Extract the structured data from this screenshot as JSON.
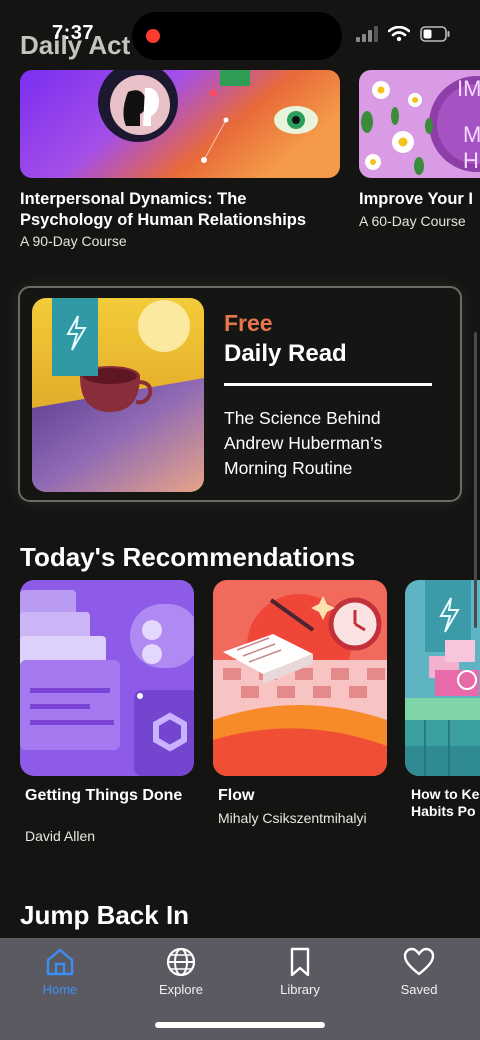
{
  "status_bar": {
    "time": "7:37"
  },
  "sections": {
    "daily_activity_title": "Daily Act",
    "recommendations_title": "Today's Recommendations",
    "jump_back_title": "Jump Back In"
  },
  "courses": [
    {
      "title": "Interpersonal Dynamics: The Psychology of Human Relationships",
      "subtitle": "A 90-Day Course"
    },
    {
      "title": "Improve Your I",
      "subtitle": "A 60-Day Course",
      "art_text_top": "IM",
      "art_text_mid": "M",
      "art_text_bot": "H"
    }
  ],
  "daily_read": {
    "badge": "Free",
    "title": "Daily Read",
    "description": "The Science Behind Andrew Huberman’s Morning Routine"
  },
  "recommendations": [
    {
      "title": "Getting Things Done",
      "author": "David Allen"
    },
    {
      "title": "Flow",
      "author": "Mihaly Csikszentmihalyi"
    },
    {
      "title": "How to Ke Habits Po",
      "author": ""
    }
  ],
  "nav": {
    "items": [
      {
        "label": "Home",
        "icon": "home-icon",
        "active": true
      },
      {
        "label": "Explore",
        "icon": "globe-icon",
        "active": false
      },
      {
        "label": "Library",
        "icon": "bookmark-icon",
        "active": false
      },
      {
        "label": "Saved",
        "icon": "heart-icon",
        "active": false
      }
    ]
  },
  "colors": {
    "accent": "#3b8ff2",
    "free": "#e5764e",
    "background": "#141412",
    "nav_bg": "#5b5962"
  }
}
